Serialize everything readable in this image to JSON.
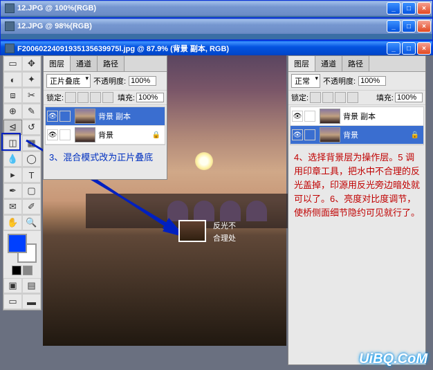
{
  "window1": {
    "title": "12.JPG @ 100%(RGB)"
  },
  "window2": {
    "title": "12.JPG @ 98%(RGB)"
  },
  "window3": {
    "title": "F20060224091935135639975l.jpg @ 87.9% (背景 副本, RGB)"
  },
  "panel": {
    "tabs": {
      "layers": "图层",
      "channels": "通道",
      "paths": "路径"
    },
    "blend_mode_multiply": "正片叠底",
    "blend_mode_normal": "正常",
    "opacity_label": "不透明度:",
    "opacity_value": "100%",
    "lock_label": "锁定:",
    "fill_label": "填充:",
    "fill_value": "100%"
  },
  "layers": {
    "copy": "背景 副本",
    "bg": "背景"
  },
  "instructions": {
    "left": "3、混合模式改为正片叠底",
    "right": "4、选择背景层为操作层。5 调用印章工具，把水中不合理的反光盖掉，印源用反光旁边暗处就可以了。6、亮度对比度调节，使桥侧面细节隐约可见就行了。"
  },
  "annotation": {
    "line1": "反光不",
    "line2": "合理处"
  },
  "watermark": "UiBQ.CoM",
  "win_btns": {
    "min": "_",
    "max": "□",
    "close": "×"
  }
}
